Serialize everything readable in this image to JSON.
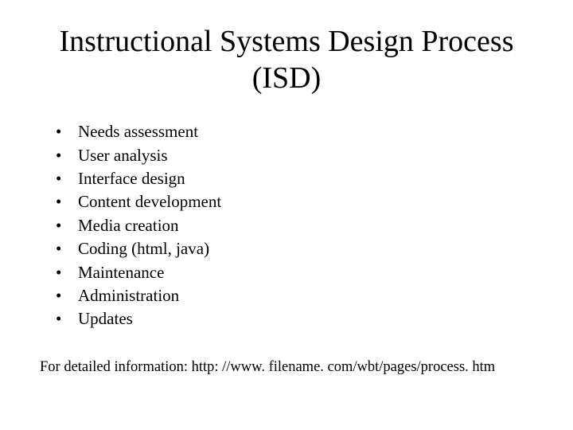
{
  "title": "Instructional Systems Design Process (ISD)",
  "bullets": [
    "Needs assessment",
    "User analysis",
    "Interface design",
    "Content development",
    "Media creation",
    "Coding (html, java)",
    "Maintenance",
    "Administration",
    "Updates"
  ],
  "footer": "For detailed information: http: //www. filename. com/wbt/pages/process. htm"
}
